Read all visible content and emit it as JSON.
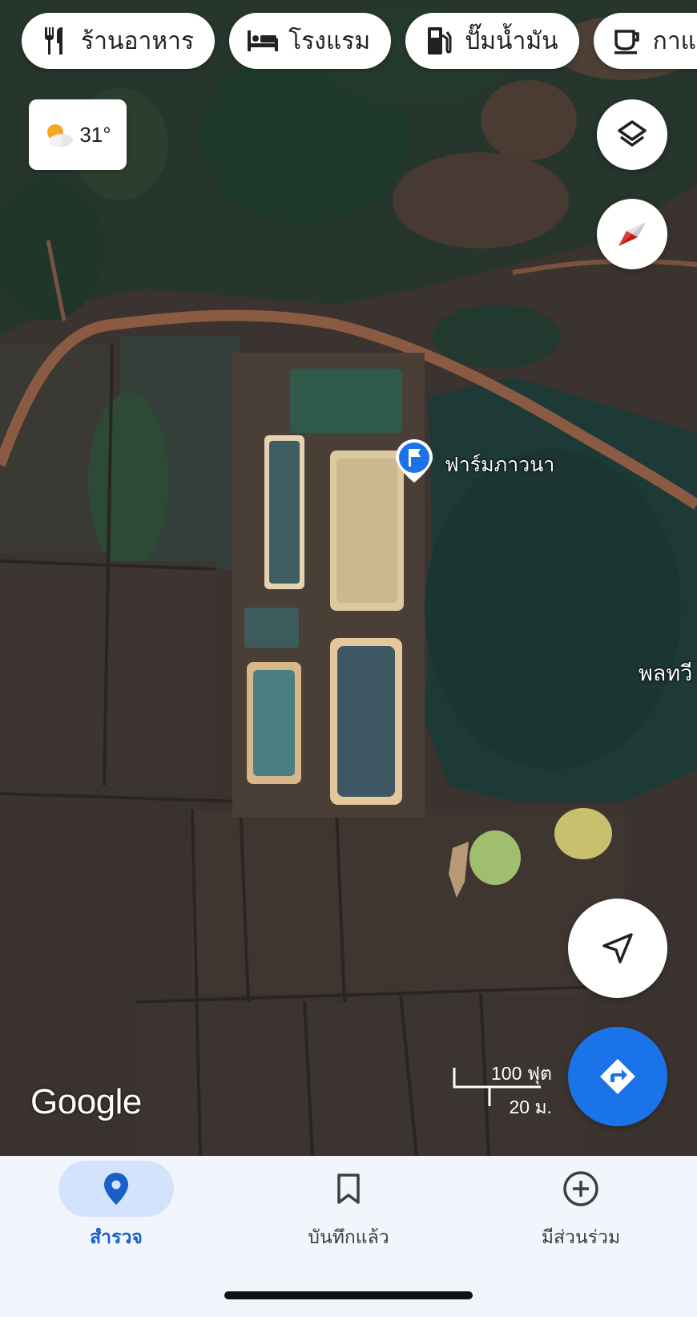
{
  "chips": [
    {
      "label": "ร้านอาหาร",
      "icon": "fork-knife-icon"
    },
    {
      "label": "โรงแรม",
      "icon": "bed-icon"
    },
    {
      "label": "ปั๊มน้ำมัน",
      "icon": "gas-pump-icon"
    },
    {
      "label": "กาแฟ",
      "icon": "coffee-cup-icon"
    }
  ],
  "weather": {
    "temperature": "31°",
    "icon": "partly-cloudy-icon"
  },
  "map": {
    "place_label": "ฟาร์มภาวนา",
    "edge_label": "พลทวี",
    "scale_imperial": "100 ฟุต",
    "scale_metric": "20 ม.",
    "logo": "Google"
  },
  "bottom_nav": [
    {
      "label": "สำรวจ",
      "icon": "location-pin-icon",
      "active": true
    },
    {
      "label": "บันทึกแล้ว",
      "icon": "bookmark-icon",
      "active": false
    },
    {
      "label": "มีส่วนร่วม",
      "icon": "add-circle-icon",
      "active": false
    }
  ],
  "colors": {
    "accent": "#1a73e8",
    "active_pill": "#d4e3fc",
    "active_text": "#1a5fc8",
    "compass_red": "#e53935"
  }
}
